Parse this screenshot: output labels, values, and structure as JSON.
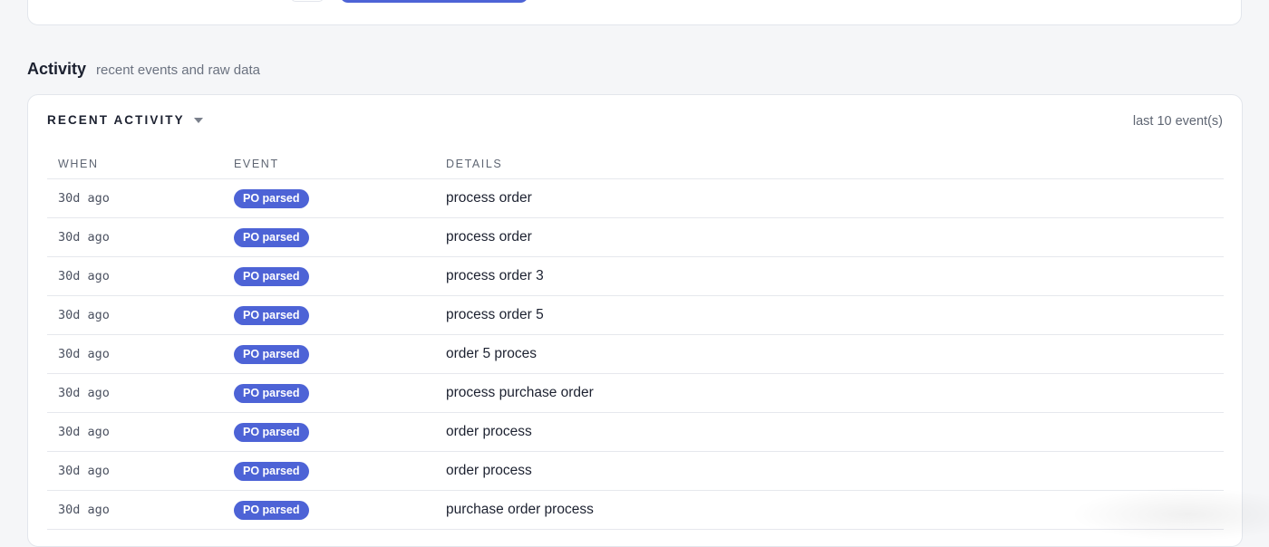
{
  "activity_section": {
    "title": "Activity",
    "subtitle": "recent events and raw data"
  },
  "recent_activity": {
    "title": "RECENT ACTIVITY",
    "count_label": "last 10 event(s)",
    "columns": [
      "WHEN",
      "EVENT",
      "DETAILS"
    ],
    "rows": [
      {
        "when": "30d ago",
        "event": "PO parsed",
        "details": "process order"
      },
      {
        "when": "30d ago",
        "event": "PO parsed",
        "details": "process order"
      },
      {
        "when": "30d ago",
        "event": "PO parsed",
        "details": "process order 3"
      },
      {
        "when": "30d ago",
        "event": "PO parsed",
        "details": "process order 5"
      },
      {
        "when": "30d ago",
        "event": "PO parsed",
        "details": "order 5 proces"
      },
      {
        "when": "30d ago",
        "event": "PO parsed",
        "details": "process purchase order"
      },
      {
        "when": "30d ago",
        "event": "PO parsed",
        "details": "order process"
      },
      {
        "when": "30d ago",
        "event": "PO parsed",
        "details": "order process"
      },
      {
        "when": "30d ago",
        "event": "PO parsed",
        "details": "purchase order process"
      }
    ]
  },
  "colors": {
    "accent": "#4d63d6",
    "background": "#f5f6f8"
  }
}
